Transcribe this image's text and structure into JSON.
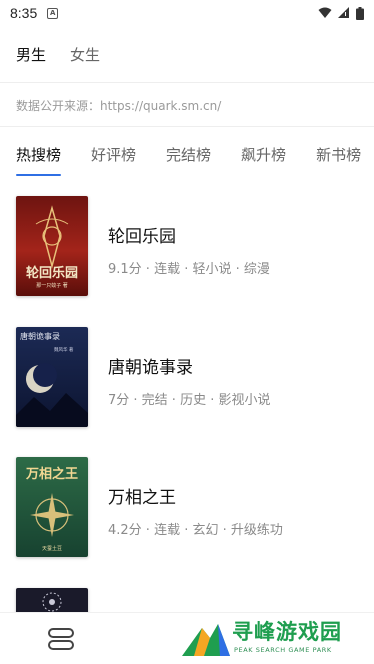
{
  "status_bar": {
    "time": "8:35",
    "notification_badge": "A",
    "icons": [
      "wifi-icon",
      "signal-icon",
      "battery-icon"
    ]
  },
  "gender_tabs": [
    {
      "label": "男生",
      "active": true
    },
    {
      "label": "女生",
      "active": false
    }
  ],
  "source_notice": "数据公开来源：https://quark.sm.cn/",
  "rank_tabs": [
    {
      "label": "热搜榜",
      "active": true
    },
    {
      "label": "好评榜",
      "active": false
    },
    {
      "label": "完结榜",
      "active": false
    },
    {
      "label": "飙升榜",
      "active": false
    },
    {
      "label": "新书榜",
      "active": false
    }
  ],
  "books": [
    {
      "title": "轮回乐园",
      "meta": "9.1分 · 连载 · 轻小说 · 综漫",
      "cover_text": "轮回乐园",
      "cover_author": "那一只蚊子 著",
      "cover_color": "#8c1a12"
    },
    {
      "title": "唐朝诡事录",
      "meta": "7分 · 完结 · 历史 · 影视小说",
      "cover_text": "唐朝诡事录",
      "cover_author": "魏风华 著",
      "cover_color": "#101a3a"
    },
    {
      "title": "万相之王",
      "meta": "4.2分 · 连载 · 玄幻 · 升级练功",
      "cover_text": "万相之王",
      "cover_author": "天蚕土豆",
      "cover_color": "#1f5a3b"
    },
    {
      "title": "",
      "meta": "",
      "cover_text": "",
      "cover_author": "",
      "cover_color": "#1a1a2a"
    }
  ],
  "watermark": {
    "title": "寻峰游戏园",
    "subtitle": "PEAK SEARCH GAME PARK"
  },
  "colors": {
    "accent": "#2f6fe4",
    "watermark_green": "#1f9e4f"
  }
}
